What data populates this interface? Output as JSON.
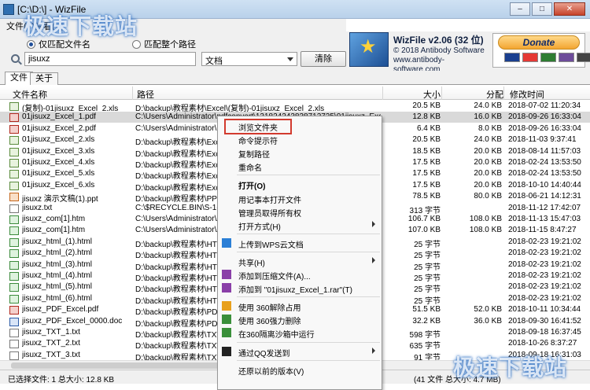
{
  "window": {
    "title": "[C:\\D:\\] - WizFile",
    "min": "–",
    "max": "□",
    "close": "✕"
  },
  "menu": {
    "file": "文件(F)",
    "view": "查看(V)"
  },
  "search": {
    "radio_filename": "仅匹配文件名",
    "radio_fullpath": "匹配整个路径",
    "query": "jisuxz",
    "filter": "文档",
    "clear_label": "清除"
  },
  "brand": {
    "title": "WizFile v2.06 (32 位)",
    "copyright": "© 2018 Antibody Software",
    "website": "www.antibody-software.com",
    "donate_label": "Donate",
    "card_colors": [
      "#1a3f8f",
      "#e53935",
      "#2e7d32",
      "#6d4c9a",
      "#444444"
    ]
  },
  "tabs": [
    {
      "label": "文件"
    },
    {
      "label": "关于"
    }
  ],
  "columns": {
    "name": "文件名称",
    "path": "路径",
    "size": "大小",
    "alloc": "分配",
    "modified": "修改时间"
  },
  "rows": [
    {
      "icon": "xls",
      "name": "(复制)-01jisuxz_Excel_2.xls",
      "path": "D:\\backup\\教程素材\\Excel\\(复制)-01jisuxz_Excel_2.xls",
      "size": "20.5 KB",
      "alloc": "24.0 KB",
      "modified": "2018-07-02 11:20:34"
    },
    {
      "icon": "pdf",
      "name": "01jisuxz_Excel_1.pdf",
      "path": "C:\\Users\\Administrator\\pdfconvert\\131824243838712725\\01jisuxz_Excel_1.pdf",
      "size": "12.8 KB",
      "alloc": "16.0 KB",
      "modified": "2018-09-26 16:33:04",
      "selected": true
    },
    {
      "icon": "pdf",
      "name": "01jisuxz_Excel_2.pdf",
      "path": "C:\\Users\\Administrator\\pdfc",
      "size": "6.4 KB",
      "alloc": "8.0 KB",
      "modified": "2018-09-26 16:33:04"
    },
    {
      "icon": "xls",
      "name": "01jisuxz_Excel_2.xls",
      "path": "D:\\backup\\教程素材\\Excel\\",
      "size": "20.5 KB",
      "alloc": "24.0 KB",
      "modified": "2018-11-03 9:37:41"
    },
    {
      "icon": "xls",
      "name": "01jisuxz_Excel_3.xls",
      "path": "D:\\backup\\教程素材\\Excel\\",
      "size": "18.5 KB",
      "alloc": "20.0 KB",
      "modified": "2018-08-14 11:57:03"
    },
    {
      "icon": "xls",
      "name": "01jisuxz_Excel_4.xls",
      "path": "D:\\backup\\教程素材\\Excel\\",
      "size": "17.5 KB",
      "alloc": "20.0 KB",
      "modified": "2018-02-24 13:53:50"
    },
    {
      "icon": "xls",
      "name": "01jisuxz_Excel_5.xls",
      "path": "D:\\backup\\教程素材\\Excel\\",
      "size": "17.5 KB",
      "alloc": "20.0 KB",
      "modified": "2018-02-24 13:53:50"
    },
    {
      "icon": "xls",
      "name": "01jisuxz_Excel_6.xls",
      "path": "D:\\backup\\教程素材\\Excel\\",
      "size": "17.5 KB",
      "alloc": "20.0 KB",
      "modified": "2018-10-10 14:40:44"
    },
    {
      "icon": "ppt",
      "name": "jisuxz 演示文稿(1).ppt",
      "path": "D:\\backup\\教程素材\\PPT\\",
      "size": "78.5 KB",
      "alloc": "80.0 KB",
      "modified": "2018-06-21 14:12:31"
    },
    {
      "icon": "txt",
      "name": "jisuxz.txt",
      "path": "C:\\$RECYCLE.BIN\\S-1-5-21",
      "size": "313 字节",
      "alloc": "",
      "modified": "2018-11-12 17:42:07"
    },
    {
      "icon": "htm",
      "name": "jisuxz_com[1].htm",
      "path": "C:\\Users\\Administrator\\App",
      "size": "106.7 KB",
      "alloc": "108.0 KB",
      "modified": "2018-11-13 15:47:03"
    },
    {
      "icon": "htm",
      "name": "jisuxz_com[1].htm",
      "path": "C:\\Users\\Administrator\\App",
      "size": "107.0 KB",
      "alloc": "108.0 KB",
      "modified": "2018-11-15 8:47:27"
    },
    {
      "icon": "htm",
      "name": "jisuxz_html_(1).html",
      "path": "D:\\backup\\教程素材\\HTML",
      "size": "25 字节",
      "alloc": "",
      "modified": "2018-02-23 19:21:02"
    },
    {
      "icon": "htm",
      "name": "jisuxz_html_(2).html",
      "path": "D:\\backup\\教程素材\\HTML",
      "size": "25 字节",
      "alloc": "",
      "modified": "2018-02-23 19:21:02"
    },
    {
      "icon": "htm",
      "name": "jisuxz_html_(3).html",
      "path": "D:\\backup\\教程素材\\HTML",
      "size": "25 字节",
      "alloc": "",
      "modified": "2018-02-23 19:21:02"
    },
    {
      "icon": "htm",
      "name": "jisuxz_html_(4).html",
      "path": "D:\\backup\\教程素材\\HTML",
      "size": "25 字节",
      "alloc": "",
      "modified": "2018-02-23 19:21:02"
    },
    {
      "icon": "htm",
      "name": "jisuxz_html_(5).html",
      "path": "D:\\backup\\教程素材\\HTML",
      "size": "25 字节",
      "alloc": "",
      "modified": "2018-02-23 19:21:02"
    },
    {
      "icon": "htm",
      "name": "jisuxz_html_(6).html",
      "path": "D:\\backup\\教程素材\\HTML",
      "size": "25 字节",
      "alloc": "",
      "modified": "2018-02-23 19:21:02"
    },
    {
      "icon": "pdf",
      "name": "jisuxz_PDF_Excel.pdf",
      "path": "D:\\backup\\教程素材\\PDF\\",
      "size": "51.5 KB",
      "alloc": "52.0 KB",
      "modified": "2018-10-11 10:34:44"
    },
    {
      "icon": "doc",
      "name": "jisuxz_PDF_Excel_0000.doc",
      "path": "D:\\backup\\教程素材\\PDF\\",
      "size": "32.2 KB",
      "alloc": "36.0 KB",
      "modified": "2018-09-30 16:41:52"
    },
    {
      "icon": "txt",
      "name": "jisuxz_TXT_1.txt",
      "path": "D:\\backup\\教程素材\\TXT\\",
      "size": "598 字节",
      "alloc": "",
      "modified": "2018-09-18 16:37:45"
    },
    {
      "icon": "txt",
      "name": "jisuxz_TXT_2.txt",
      "path": "D:\\backup\\教程素材\\TXT\\",
      "size": "635 字节",
      "alloc": "",
      "modified": "2018-10-26 8:37:27"
    },
    {
      "icon": "txt",
      "name": "jisuxz_TXT_3.txt",
      "path": "D:\\backup\\教程素材\\TXT\\",
      "size": "91 字节",
      "alloc": "",
      "modified": "2018-09-18 16:31:03"
    }
  ],
  "context_menu": [
    {
      "label": "浏览文件夹",
      "highlighted": true
    },
    {
      "label": "命令提示符"
    },
    {
      "label": "复制路径"
    },
    {
      "label": "重命名"
    },
    {
      "sep": true
    },
    {
      "label": "打开(O)",
      "bold": true
    },
    {
      "label": "用记事本打开文件"
    },
    {
      "label": "管理员取得所有权"
    },
    {
      "label": "打开方式(H)",
      "submenu": true
    },
    {
      "sep": true
    },
    {
      "label": "上传到WPS云文档",
      "icon": "cloud-icon"
    },
    {
      "sep": true
    },
    {
      "label": "共享(H)",
      "submenu": true
    },
    {
      "label": "添加到压缩文件(A)...",
      "icon": "archive-icon"
    },
    {
      "label": "添加到 \"01jisuxz_Excel_1.rar\"(T)",
      "icon": "archive-icon"
    },
    {
      "sep": true
    },
    {
      "label": "使用 360解除占用",
      "icon": "unlock-icon"
    },
    {
      "label": "使用 360强力删除",
      "icon": "shred-icon"
    },
    {
      "label": "在360隔离沙箱中运行",
      "icon": "sandbox-icon"
    },
    {
      "sep": true
    },
    {
      "label": "通过QQ发送到",
      "submenu": true,
      "icon": "qq-icon"
    },
    {
      "sep": true
    },
    {
      "label": "还原以前的版本(V)"
    }
  ],
  "status": {
    "left": "已选择文件: 1  总大小: 12.8 KB",
    "right": "(41 文件  总大小: 4.7 MB)"
  },
  "watermark": {
    "text": "极速下载站"
  }
}
